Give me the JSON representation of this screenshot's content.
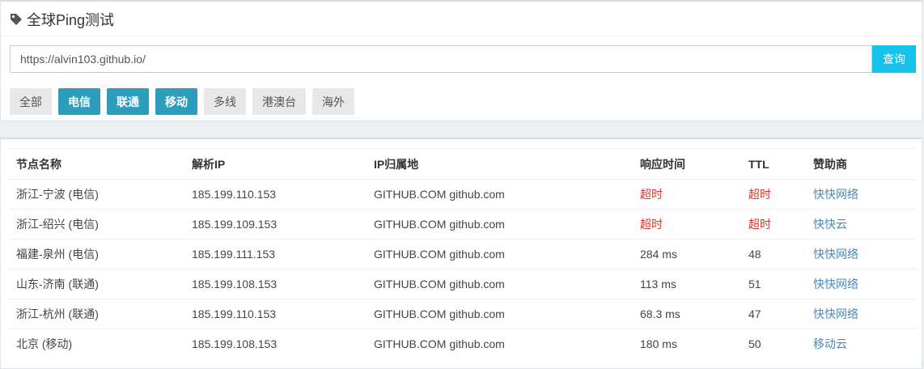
{
  "header": {
    "title": "全球Ping测试",
    "icon": "tag-icon"
  },
  "search": {
    "value": "https://alvin103.github.io/",
    "button_label": "查询"
  },
  "filters": [
    {
      "label": "全部",
      "active": false
    },
    {
      "label": "电信",
      "active": true
    },
    {
      "label": "联通",
      "active": true
    },
    {
      "label": "移动",
      "active": true
    },
    {
      "label": "多线",
      "active": false
    },
    {
      "label": "港澳台",
      "active": false
    },
    {
      "label": "海外",
      "active": false
    }
  ],
  "table": {
    "columns": [
      "节点名称",
      "解析IP",
      "IP归属地",
      "响应时间",
      "TTL",
      "赞助商"
    ],
    "rows": [
      [
        "浙江-宁波 (电信)",
        "185.199.110.153",
        "GITHUB.COM github.com",
        "超时",
        "超时",
        "快快网络"
      ],
      [
        "浙江-绍兴 (电信)",
        "185.199.109.153",
        "GITHUB.COM github.com",
        "超时",
        "超时",
        "快快云"
      ],
      [
        "福建-泉州 (电信)",
        "185.199.111.153",
        "GITHUB.COM github.com",
        "284 ms",
        "48",
        "快快网络"
      ],
      [
        "山东-济南 (联通)",
        "185.199.108.153",
        "GITHUB.COM github.com",
        "113 ms",
        "51",
        "快快网络"
      ],
      [
        "浙江-杭州 (联通)",
        "185.199.110.153",
        "GITHUB.COM github.com",
        "68.3 ms",
        "47",
        "快快网络"
      ],
      [
        "北京 (移动)",
        "185.199.108.153",
        "GITHUB.COM github.com",
        "180 ms",
        "50",
        "移动云"
      ]
    ]
  },
  "colors": {
    "accent": "#14c2ea",
    "active_filter": "#2c9ebc",
    "timeout": "#d9342b",
    "sponsor_link": "#4a8ab7"
  }
}
